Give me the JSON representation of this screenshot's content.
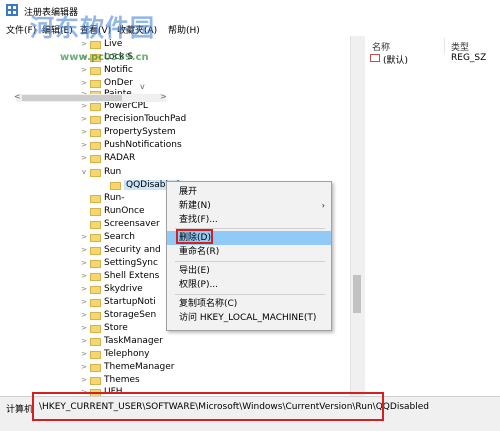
{
  "window": {
    "title": "注册表编辑器"
  },
  "watermark": {
    "text": "河东软件园",
    "url": "www.pc0359.cn"
  },
  "menu": [
    "文件(F)",
    "编辑(E)",
    "查看(V)",
    "收藏夹(A)",
    "帮助(H)"
  ],
  "tree": {
    "top_items": [
      "Live",
      "Lock S",
      "Notific",
      "OnDer",
      "Painte"
    ],
    "items": [
      {
        "label": "PowerCPL"
      },
      {
        "label": "PrecisionTouchPad"
      },
      {
        "label": "PropertySystem"
      },
      {
        "label": "PushNotifications"
      },
      {
        "label": "RADAR"
      },
      {
        "label": "Run"
      },
      {
        "label": "QQDisabled"
      },
      {
        "label": "Run-"
      },
      {
        "label": "RunOnce"
      },
      {
        "label": "Screensaver"
      },
      {
        "label": "Search"
      },
      {
        "label": "Security and"
      },
      {
        "label": "SettingSync"
      },
      {
        "label": "Shell Extens"
      },
      {
        "label": "Skydrive"
      },
      {
        "label": "StartupNoti"
      },
      {
        "label": "StorageSen"
      },
      {
        "label": "Store"
      },
      {
        "label": "TaskManager"
      },
      {
        "label": "Telephony"
      },
      {
        "label": "ThemeManager"
      },
      {
        "label": "Themes"
      },
      {
        "label": "UFH"
      }
    ]
  },
  "values_pane": {
    "col_name": "名称",
    "col_type": "类型",
    "rows": [
      {
        "name": "(默认)",
        "type": "REG_SZ"
      }
    ]
  },
  "context_menu": {
    "items": [
      "展开",
      "新建(N)",
      "查找(F)...",
      "删除(D)",
      "重命名(R)",
      "导出(E)",
      "权限(P)...",
      "复制项名称(C)",
      "访问 HKEY_LOCAL_MACHINE(T)"
    ],
    "submenu_arrow": "›"
  },
  "status": {
    "prefix": "计算机",
    "path": "\\HKEY_CURRENT_USER\\SOFTWARE\\Microsoft\\Windows\\CurrentVersion\\Run\\QQDisabled"
  },
  "colors": {
    "highlight": "#91c9f7",
    "annotation": "#d42020",
    "folder": "#f5d76e"
  }
}
